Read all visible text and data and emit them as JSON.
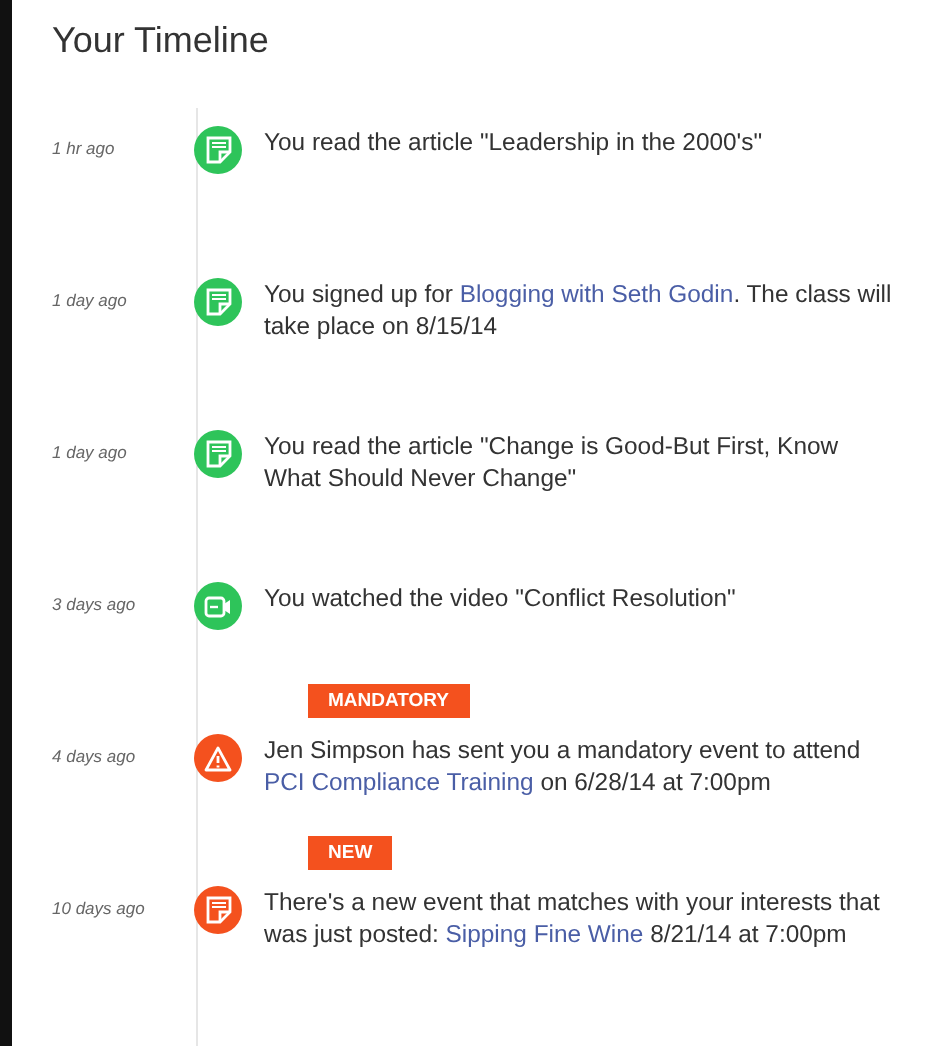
{
  "title": "Your Timeline",
  "events": [
    {
      "time": "1 hr ago",
      "kind": "document",
      "color": "#2ec45a",
      "parts": [
        {
          "text": "You read the article \"Leadership in the 2000's\"",
          "link": false
        }
      ]
    },
    {
      "time": "1 day ago",
      "kind": "document",
      "color": "#2ec45a",
      "parts": [
        {
          "text": "You signed up for ",
          "link": false
        },
        {
          "text": "Blogging with Seth Godin",
          "link": true
        },
        {
          "text": ". The class will take place on 8/15/14",
          "link": false
        }
      ]
    },
    {
      "time": "1 day ago",
      "kind": "document",
      "color": "#2ec45a",
      "parts": [
        {
          "text": "You read the article \"Change is Good-But First, Know What Should Never Change\"",
          "link": false
        }
      ]
    },
    {
      "time": "3 days ago",
      "kind": "video",
      "color": "#2ec45a",
      "parts": [
        {
          "text": "You watched the video \"Conflict Resolution\"",
          "link": false
        }
      ]
    },
    {
      "time": "4 days ago",
      "kind": "warning",
      "color": "#f4511e",
      "badge": "MANDATORY",
      "parts": [
        {
          "text": "Jen Simpson has sent you a mandatory event to attend ",
          "link": false
        },
        {
          "text": "PCI Compliance Training",
          "link": true
        },
        {
          "text": " on 6/28/14 at 7:00pm",
          "link": false
        }
      ]
    },
    {
      "time": "10 days ago",
      "kind": "document",
      "color": "#f4511e",
      "badge": "NEW",
      "parts": [
        {
          "text": "There's a new event that matches with your interests that was just posted: ",
          "link": false
        },
        {
          "text": "Sipping Fine Wine",
          "link": true
        },
        {
          "text": " 8/21/14 at 7:00pm",
          "link": false
        }
      ]
    }
  ]
}
